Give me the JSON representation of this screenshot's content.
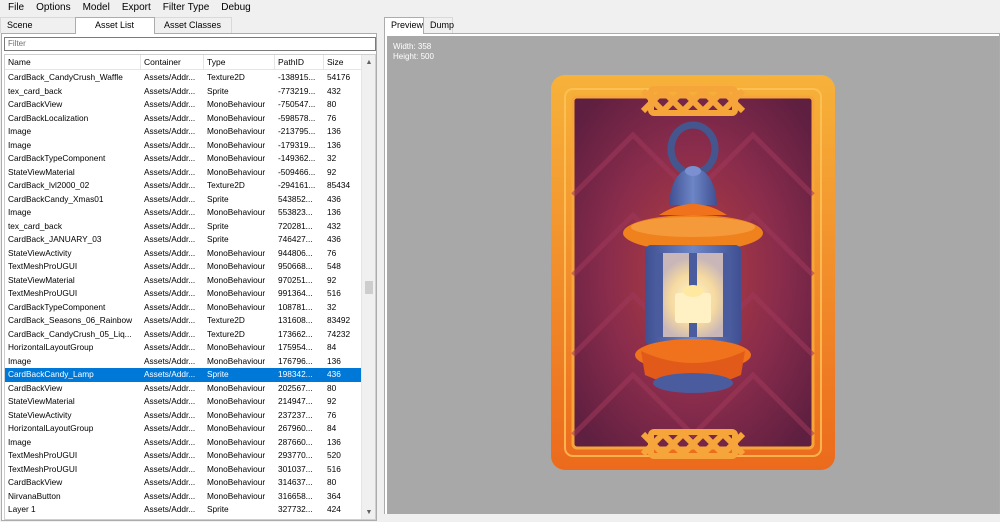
{
  "menu": [
    "File",
    "Options",
    "Model",
    "Export",
    "Filter Type",
    "Debug"
  ],
  "left_tabs": [
    "Scene Hierarchy",
    "Asset List",
    "Asset Classes"
  ],
  "filter_placeholder": "Filter",
  "columns": [
    "Name",
    "Container",
    "Type",
    "PathID",
    "Size"
  ],
  "rows": [
    [
      "CardBack_CandyCrush_Waffle",
      "Assets/Addr...",
      "Texture2D",
      "-138915...",
      "54176"
    ],
    [
      "tex_card_back",
      "Assets/Addr...",
      "Sprite",
      "-773219...",
      "432"
    ],
    [
      "CardBackView",
      "Assets/Addr...",
      "MonoBehaviour",
      "-750547...",
      "80"
    ],
    [
      "CardBackLocalization",
      "Assets/Addr...",
      "MonoBehaviour",
      "-598578...",
      "76"
    ],
    [
      "Image",
      "Assets/Addr...",
      "MonoBehaviour",
      "-213795...",
      "136"
    ],
    [
      "Image",
      "Assets/Addr...",
      "MonoBehaviour",
      "-179319...",
      "136"
    ],
    [
      "CardBackTypeComponent",
      "Assets/Addr...",
      "MonoBehaviour",
      "-149362...",
      "32"
    ],
    [
      "StateViewMaterial",
      "Assets/Addr...",
      "MonoBehaviour",
      "-509466...",
      "92"
    ],
    [
      "CardBack_lvl2000_02",
      "Assets/Addr...",
      "Texture2D",
      "-294161...",
      "85434"
    ],
    [
      "CardBackCandy_Xmas01",
      "Assets/Addr...",
      "Sprite",
      "543852...",
      "436"
    ],
    [
      "Image",
      "Assets/Addr...",
      "MonoBehaviour",
      "553823...",
      "136"
    ],
    [
      "tex_card_back",
      "Assets/Addr...",
      "Sprite",
      "720281...",
      "432"
    ],
    [
      "CardBack_JANUARY_03",
      "Assets/Addr...",
      "Sprite",
      "746427...",
      "436"
    ],
    [
      "StateViewActivity",
      "Assets/Addr...",
      "MonoBehaviour",
      "944806...",
      "76"
    ],
    [
      "TextMeshProUGUI",
      "Assets/Addr...",
      "MonoBehaviour",
      "950668...",
      "548"
    ],
    [
      "StateViewMaterial",
      "Assets/Addr...",
      "MonoBehaviour",
      "970251...",
      "92"
    ],
    [
      "TextMeshProUGUI",
      "Assets/Addr...",
      "MonoBehaviour",
      "991364...",
      "516"
    ],
    [
      "CardBackTypeComponent",
      "Assets/Addr...",
      "MonoBehaviour",
      "108781...",
      "32"
    ],
    [
      "CardBack_Seasons_06_Rainbow",
      "Assets/Addr...",
      "Texture2D",
      "131608...",
      "83492"
    ],
    [
      "CardBack_CandyCrush_05_Liq...",
      "Assets/Addr...",
      "Texture2D",
      "173662...",
      "74232"
    ],
    [
      "HorizontalLayoutGroup",
      "Assets/Addr...",
      "MonoBehaviour",
      "175954...",
      "84"
    ],
    [
      "Image",
      "Assets/Addr...",
      "MonoBehaviour",
      "176796...",
      "136"
    ],
    [
      "CardBackCandy_Lamp",
      "Assets/Addr...",
      "Sprite",
      "198342...",
      "436"
    ],
    [
      "CardBackView",
      "Assets/Addr...",
      "MonoBehaviour",
      "202567...",
      "80"
    ],
    [
      "StateViewMaterial",
      "Assets/Addr...",
      "MonoBehaviour",
      "214947...",
      "92"
    ],
    [
      "StateViewActivity",
      "Assets/Addr...",
      "MonoBehaviour",
      "237237...",
      "76"
    ],
    [
      "HorizontalLayoutGroup",
      "Assets/Addr...",
      "MonoBehaviour",
      "267960...",
      "84"
    ],
    [
      "Image",
      "Assets/Addr...",
      "MonoBehaviour",
      "287660...",
      "136"
    ],
    [
      "TextMeshProUGUI",
      "Assets/Addr...",
      "MonoBehaviour",
      "293770...",
      "520"
    ],
    [
      "TextMeshProUGUI",
      "Assets/Addr...",
      "MonoBehaviour",
      "301037...",
      "516"
    ],
    [
      "CardBackView",
      "Assets/Addr...",
      "MonoBehaviour",
      "314637...",
      "80"
    ],
    [
      "NirvanaButton",
      "Assets/Addr...",
      "MonoBehaviour",
      "316658...",
      "364"
    ],
    [
      "Layer 1",
      "Assets/Addr...",
      "Sprite",
      "327732...",
      "424"
    ]
  ],
  "selected_row_index": 22,
  "scroll_position": 0.5,
  "right_tabs": [
    "Preview",
    "Dump"
  ],
  "preview": {
    "width_label": "Width: 358",
    "height_label": "Height: 500"
  },
  "colors": {
    "selection": "#0078d7",
    "preview_bg": "#a8a8a8",
    "card_frame": "#f0962a",
    "card_inner": "#7a2a52",
    "lantern_body": "#5a70b0",
    "lantern_trim": "#f0721c",
    "candle_glow": "#fce6a8"
  },
  "icons": {
    "scroll_up": "triangle-up-icon",
    "scroll_down": "triangle-down-icon"
  }
}
